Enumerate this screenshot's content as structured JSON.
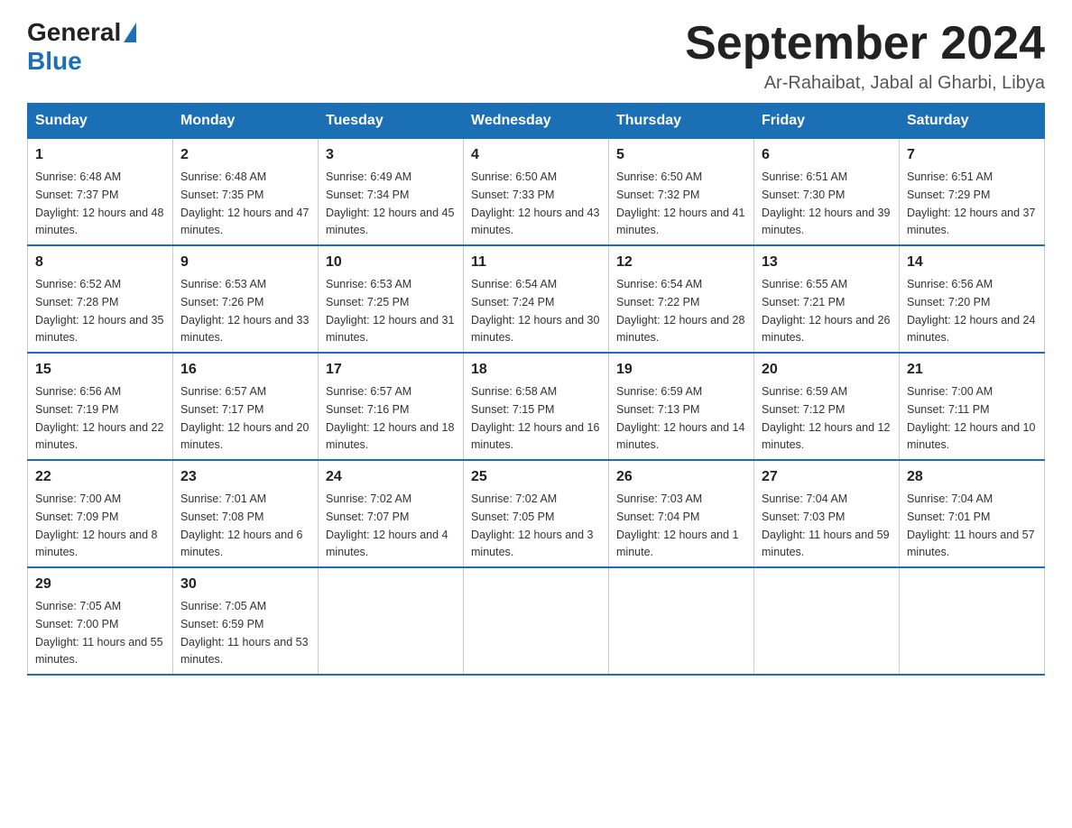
{
  "header": {
    "logo_general": "General",
    "logo_blue": "Blue",
    "month_title": "September 2024",
    "subtitle": "Ar-Rahaibat, Jabal al Gharbi, Libya"
  },
  "weekdays": [
    "Sunday",
    "Monday",
    "Tuesday",
    "Wednesday",
    "Thursday",
    "Friday",
    "Saturday"
  ],
  "weeks": [
    [
      {
        "day": "1",
        "sunrise": "6:48 AM",
        "sunset": "7:37 PM",
        "daylight": "12 hours and 48 minutes."
      },
      {
        "day": "2",
        "sunrise": "6:48 AM",
        "sunset": "7:35 PM",
        "daylight": "12 hours and 47 minutes."
      },
      {
        "day": "3",
        "sunrise": "6:49 AM",
        "sunset": "7:34 PM",
        "daylight": "12 hours and 45 minutes."
      },
      {
        "day": "4",
        "sunrise": "6:50 AM",
        "sunset": "7:33 PM",
        "daylight": "12 hours and 43 minutes."
      },
      {
        "day": "5",
        "sunrise": "6:50 AM",
        "sunset": "7:32 PM",
        "daylight": "12 hours and 41 minutes."
      },
      {
        "day": "6",
        "sunrise": "6:51 AM",
        "sunset": "7:30 PM",
        "daylight": "12 hours and 39 minutes."
      },
      {
        "day": "7",
        "sunrise": "6:51 AM",
        "sunset": "7:29 PM",
        "daylight": "12 hours and 37 minutes."
      }
    ],
    [
      {
        "day": "8",
        "sunrise": "6:52 AM",
        "sunset": "7:28 PM",
        "daylight": "12 hours and 35 minutes."
      },
      {
        "day": "9",
        "sunrise": "6:53 AM",
        "sunset": "7:26 PM",
        "daylight": "12 hours and 33 minutes."
      },
      {
        "day": "10",
        "sunrise": "6:53 AM",
        "sunset": "7:25 PM",
        "daylight": "12 hours and 31 minutes."
      },
      {
        "day": "11",
        "sunrise": "6:54 AM",
        "sunset": "7:24 PM",
        "daylight": "12 hours and 30 minutes."
      },
      {
        "day": "12",
        "sunrise": "6:54 AM",
        "sunset": "7:22 PM",
        "daylight": "12 hours and 28 minutes."
      },
      {
        "day": "13",
        "sunrise": "6:55 AM",
        "sunset": "7:21 PM",
        "daylight": "12 hours and 26 minutes."
      },
      {
        "day": "14",
        "sunrise": "6:56 AM",
        "sunset": "7:20 PM",
        "daylight": "12 hours and 24 minutes."
      }
    ],
    [
      {
        "day": "15",
        "sunrise": "6:56 AM",
        "sunset": "7:19 PM",
        "daylight": "12 hours and 22 minutes."
      },
      {
        "day": "16",
        "sunrise": "6:57 AM",
        "sunset": "7:17 PM",
        "daylight": "12 hours and 20 minutes."
      },
      {
        "day": "17",
        "sunrise": "6:57 AM",
        "sunset": "7:16 PM",
        "daylight": "12 hours and 18 minutes."
      },
      {
        "day": "18",
        "sunrise": "6:58 AM",
        "sunset": "7:15 PM",
        "daylight": "12 hours and 16 minutes."
      },
      {
        "day": "19",
        "sunrise": "6:59 AM",
        "sunset": "7:13 PM",
        "daylight": "12 hours and 14 minutes."
      },
      {
        "day": "20",
        "sunrise": "6:59 AM",
        "sunset": "7:12 PM",
        "daylight": "12 hours and 12 minutes."
      },
      {
        "day": "21",
        "sunrise": "7:00 AM",
        "sunset": "7:11 PM",
        "daylight": "12 hours and 10 minutes."
      }
    ],
    [
      {
        "day": "22",
        "sunrise": "7:00 AM",
        "sunset": "7:09 PM",
        "daylight": "12 hours and 8 minutes."
      },
      {
        "day": "23",
        "sunrise": "7:01 AM",
        "sunset": "7:08 PM",
        "daylight": "12 hours and 6 minutes."
      },
      {
        "day": "24",
        "sunrise": "7:02 AM",
        "sunset": "7:07 PM",
        "daylight": "12 hours and 4 minutes."
      },
      {
        "day": "25",
        "sunrise": "7:02 AM",
        "sunset": "7:05 PM",
        "daylight": "12 hours and 3 minutes."
      },
      {
        "day": "26",
        "sunrise": "7:03 AM",
        "sunset": "7:04 PM",
        "daylight": "12 hours and 1 minute."
      },
      {
        "day": "27",
        "sunrise": "7:04 AM",
        "sunset": "7:03 PM",
        "daylight": "11 hours and 59 minutes."
      },
      {
        "day": "28",
        "sunrise": "7:04 AM",
        "sunset": "7:01 PM",
        "daylight": "11 hours and 57 minutes."
      }
    ],
    [
      {
        "day": "29",
        "sunrise": "7:05 AM",
        "sunset": "7:00 PM",
        "daylight": "11 hours and 55 minutes."
      },
      {
        "day": "30",
        "sunrise": "7:05 AM",
        "sunset": "6:59 PM",
        "daylight": "11 hours and 53 minutes."
      },
      null,
      null,
      null,
      null,
      null
    ]
  ]
}
